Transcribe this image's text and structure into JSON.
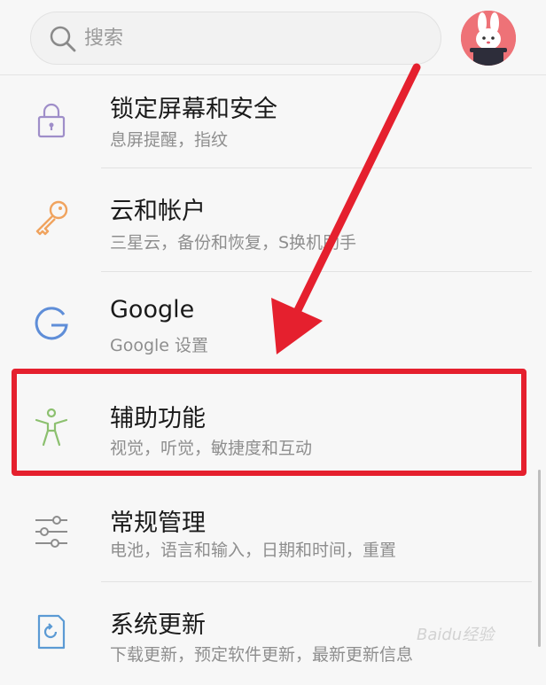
{
  "search": {
    "placeholder": "搜索"
  },
  "settings": [
    {
      "title": "锁定屏幕和安全",
      "subtitle": "息屏提醒，指纹",
      "icon": "lock-icon"
    },
    {
      "title": "云和帐户",
      "subtitle": "三星云，备份和恢复，S换机助手",
      "icon": "key-icon"
    },
    {
      "title": "Google",
      "subtitle": "Google 设置",
      "icon": "google-icon"
    },
    {
      "title": "辅助功能",
      "subtitle": "视觉，听觉，敏捷度和互动",
      "icon": "accessibility-icon"
    },
    {
      "title": "常规管理",
      "subtitle": "电池，语言和输入，日期和时间，重置",
      "icon": "sliders-icon"
    },
    {
      "title": "系统更新",
      "subtitle": "下载更新，预定软件更新，最新更新信息",
      "icon": "system-update-icon"
    }
  ],
  "watermark": "Baidu经验",
  "colors": {
    "highlight": "#e5202e",
    "lock": "#9f8ec9",
    "key": "#f0a35e",
    "google": "#5f8ed8",
    "accessibility": "#8cc06f",
    "sliders": "#8d8d8d",
    "update": "#5b9ad4"
  }
}
